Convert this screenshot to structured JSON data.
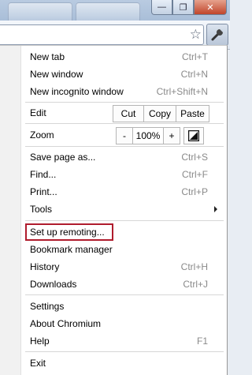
{
  "toolbar": {
    "star_icon": "star-icon",
    "wrench_icon": "wrench-icon"
  },
  "window": {
    "minimize": "—",
    "restore": "❐",
    "close": "✕"
  },
  "menu": {
    "new_tab": {
      "label": "New tab",
      "shortcut": "Ctrl+T"
    },
    "new_window": {
      "label": "New window",
      "shortcut": "Ctrl+N"
    },
    "new_incognito": {
      "label": "New incognito window",
      "shortcut": "Ctrl+Shift+N"
    },
    "edit": {
      "label": "Edit",
      "cut": "Cut",
      "copy": "Copy",
      "paste": "Paste"
    },
    "zoom": {
      "label": "Zoom",
      "minus": "-",
      "level": "100%",
      "plus": "+"
    },
    "save_page": {
      "label": "Save page as...",
      "shortcut": "Ctrl+S"
    },
    "find": {
      "label": "Find...",
      "shortcut": "Ctrl+F"
    },
    "print": {
      "label": "Print...",
      "shortcut": "Ctrl+P"
    },
    "tools": {
      "label": "Tools"
    },
    "set_up_remoting": {
      "label": "Set up remoting..."
    },
    "bookmark_manager": {
      "label": "Bookmark manager"
    },
    "history": {
      "label": "History",
      "shortcut": "Ctrl+H"
    },
    "downloads": {
      "label": "Downloads",
      "shortcut": "Ctrl+J"
    },
    "settings": {
      "label": "Settings"
    },
    "about": {
      "label": "About Chromium"
    },
    "help": {
      "label": "Help",
      "shortcut": "F1"
    },
    "exit": {
      "label": "Exit"
    }
  },
  "colors": {
    "highlight_border": "#b01c2d",
    "shortcut_text": "#8a8a8a"
  }
}
